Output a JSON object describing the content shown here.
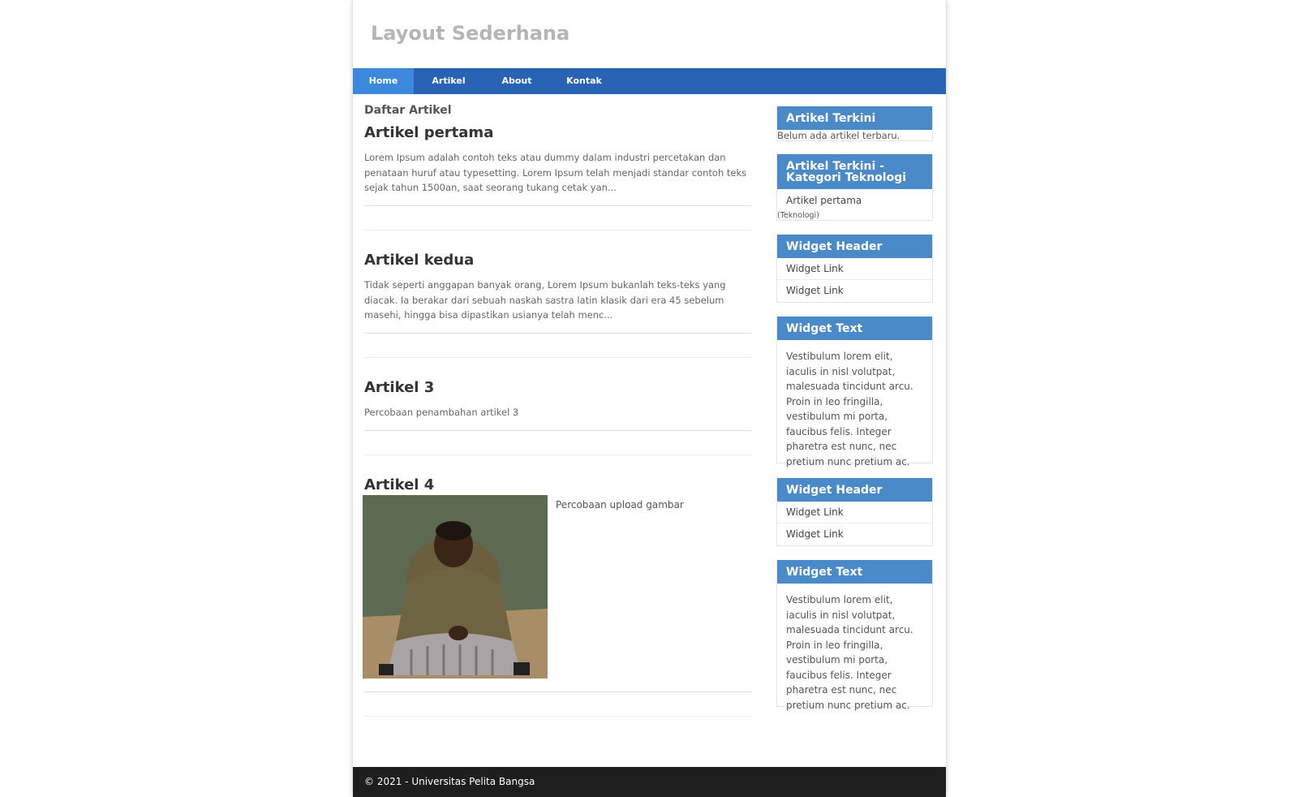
{
  "header": {
    "title": "Layout Sederhana"
  },
  "nav": {
    "items": [
      {
        "label": "Home",
        "active": true
      },
      {
        "label": "Artikel"
      },
      {
        "label": "About"
      },
      {
        "label": "Kontak"
      }
    ]
  },
  "main": {
    "section_title": "Daftar Artikel",
    "articles": [
      {
        "title": "Artikel pertama",
        "excerpt": "Lorem Ipsum adalah contoh teks atau dummy dalam industri percetakan dan penataan huruf atau typesetting. Lorem Ipsum telah menjadi standar contoh teks sejak tahun 1500an, saat seorang tukang cetak yan..."
      },
      {
        "title": "Artikel kedua",
        "excerpt": "Tidak seperti anggapan banyak orang, Lorem Ipsum bukanlah teks-teks yang diacak. Ia berakar dari sebuah naskah sastra latin klasik dari era 45 sebelum masehi, hingga bisa dipastikan usianya telah menc..."
      },
      {
        "title": "Artikel 3",
        "excerpt": "Percobaan penambahan artikel 3"
      },
      {
        "title": "Artikel 4",
        "excerpt": "Percobaan upload gambar"
      }
    ]
  },
  "sidebar": {
    "widget1": {
      "header": "Artikel Terkini",
      "text": "Belum ada artikel terbaru."
    },
    "widget2": {
      "header": "Artikel Terkini - Kategori Teknologi",
      "link": "Artikel pertama",
      "category": "(Teknologi)"
    },
    "widget3": {
      "header": "Widget Header",
      "links": [
        "Widget Link",
        "Widget Link"
      ]
    },
    "widget4": {
      "header": "Widget Text",
      "text": "Vestibulum lorem elit, iaculis in nisl volutpat, malesuada tincidunt arcu. Proin in leo fringilla, vestibulum mi porta, faucibus felis. Integer pharetra est nunc, nec pretium nunc pretium ac."
    },
    "widget5": {
      "header": "Widget Header",
      "links": [
        "Widget Link",
        "Widget Link"
      ]
    },
    "widget6": {
      "header": "Widget Text",
      "text": "Vestibulum lorem elit, iaculis in nisl volutpat, malesuada tincidunt arcu. Proin in leo fringilla, vestibulum mi porta, faucibus felis. Integer pharetra est nunc, nec pretium nunc pretium ac."
    }
  },
  "footer": {
    "text": "© 2021 - Universitas Pelita Bangsa"
  },
  "colors": {
    "nav": "#2963b5",
    "nav_active": "#3c88dc",
    "widget_header": "#4a8ac8",
    "footer": "#1e1e1e"
  }
}
